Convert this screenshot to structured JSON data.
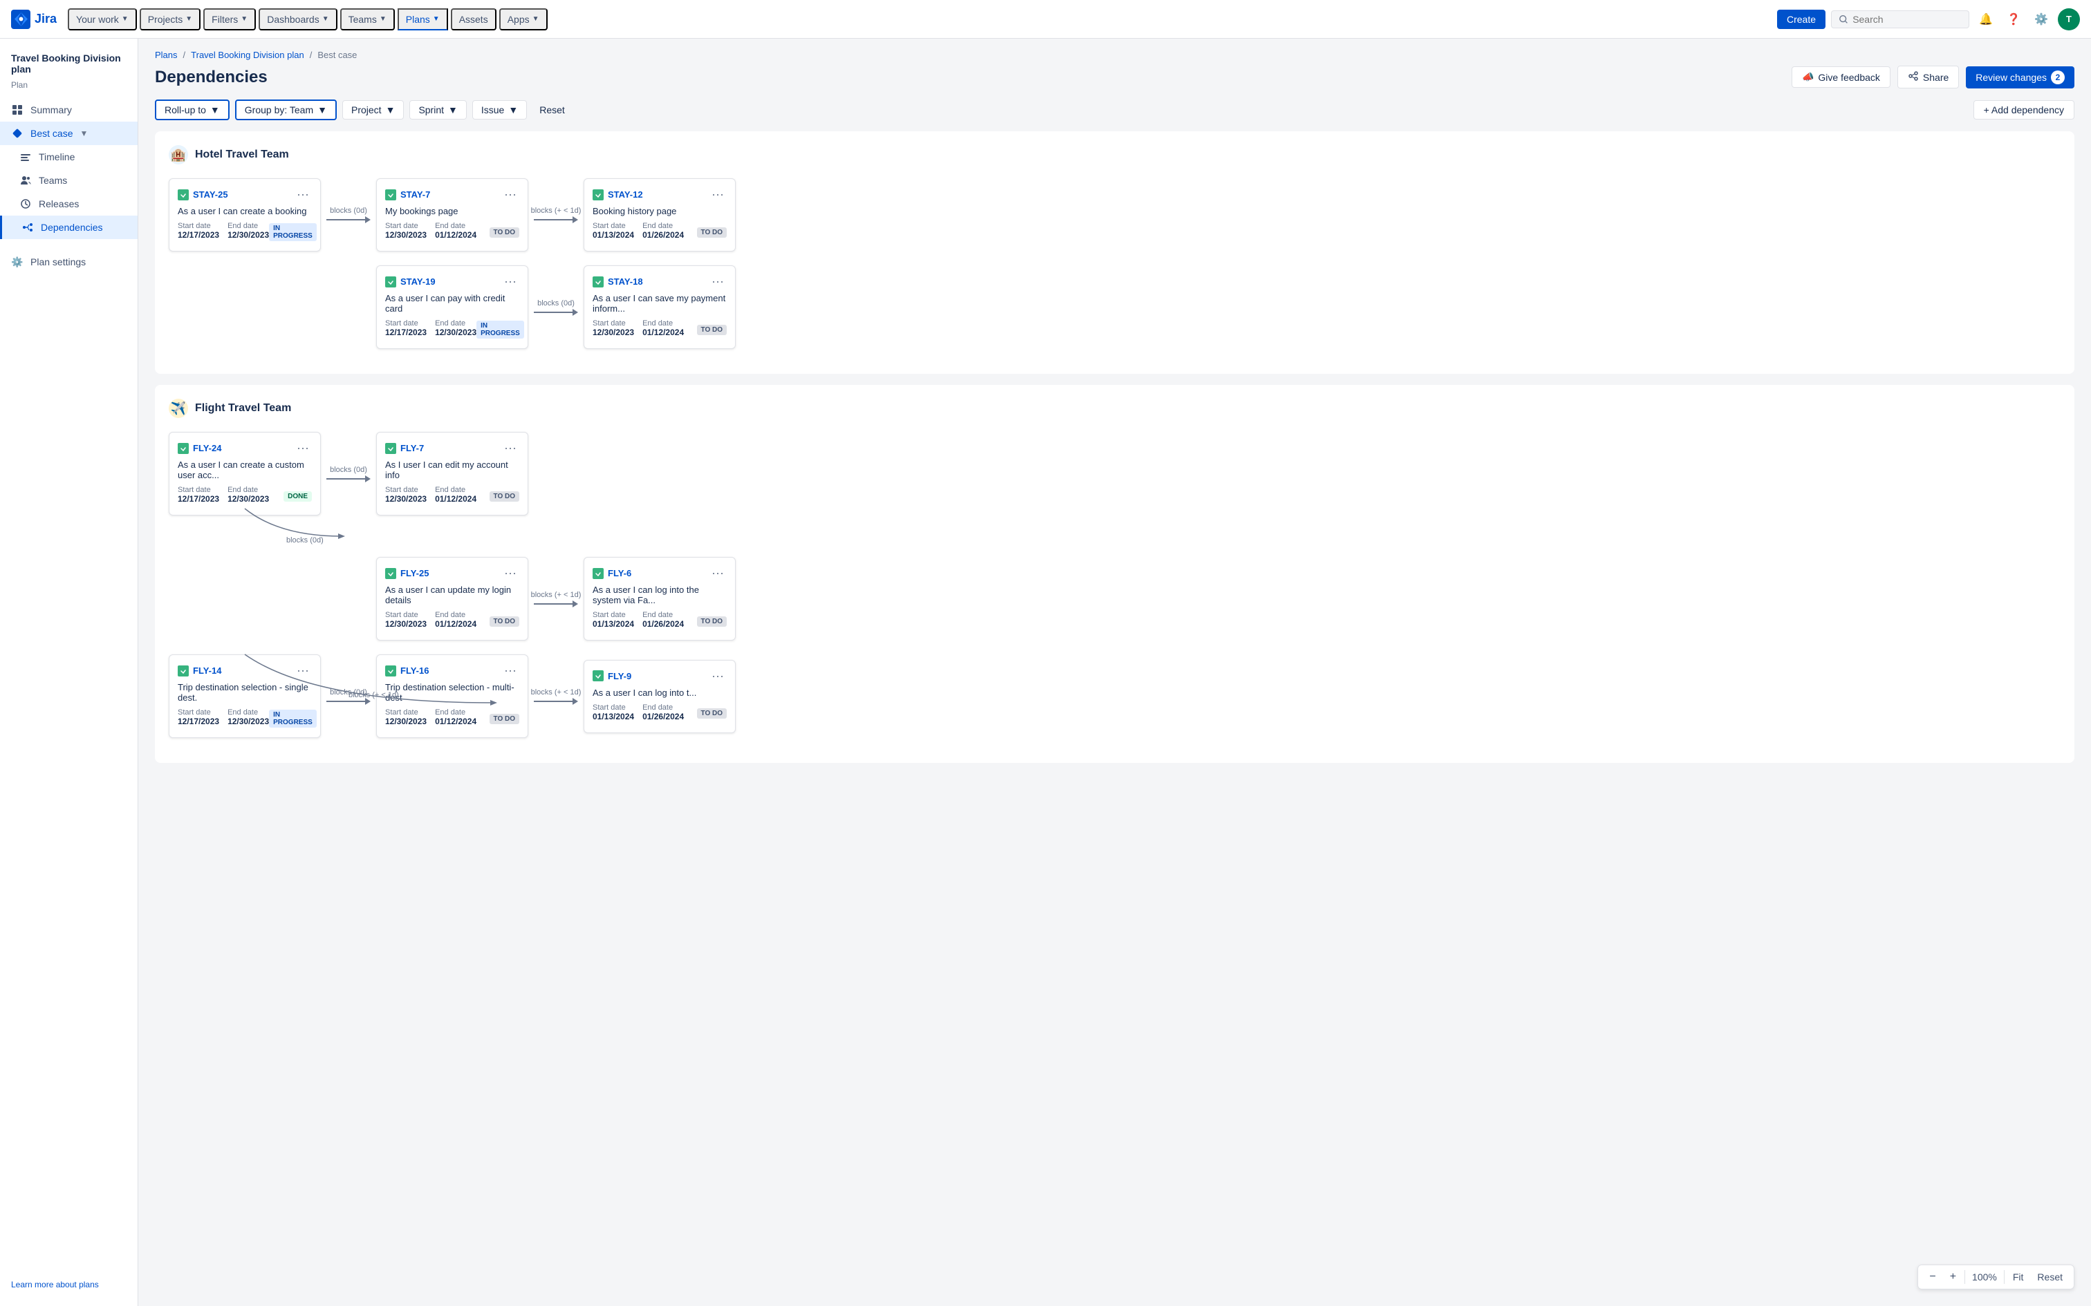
{
  "nav": {
    "logo_text": "Jira",
    "items": [
      {
        "label": "Your work",
        "has_chevron": true
      },
      {
        "label": "Projects",
        "has_chevron": true
      },
      {
        "label": "Filters",
        "has_chevron": true
      },
      {
        "label": "Dashboards",
        "has_chevron": true
      },
      {
        "label": "Teams",
        "has_chevron": true
      },
      {
        "label": "Plans",
        "has_chevron": true,
        "active": true
      },
      {
        "label": "Assets",
        "has_chevron": false
      },
      {
        "label": "Apps",
        "has_chevron": true
      }
    ],
    "create_label": "Create",
    "search_placeholder": "Search"
  },
  "sidebar": {
    "plan_title": "Travel Booking Division plan",
    "plan_sub": "Plan",
    "items": [
      {
        "label": "Summary",
        "icon": "grid"
      },
      {
        "label": "Best case",
        "icon": "diamond",
        "active": true,
        "expandable": true
      },
      {
        "label": "Timeline",
        "icon": "timeline"
      },
      {
        "label": "Teams",
        "icon": "teams"
      },
      {
        "label": "Releases",
        "icon": "releases"
      },
      {
        "label": "Dependencies",
        "icon": "deps",
        "selected": true
      }
    ],
    "settings_label": "Plan settings",
    "learn_label": "Learn more about plans"
  },
  "breadcrumbs": [
    "Plans",
    "Travel Booking Division plan",
    "Best case"
  ],
  "page_title": "Dependencies",
  "actions": {
    "feedback_label": "Give feedback",
    "share_label": "Share",
    "review_label": "Review changes",
    "review_count": "2"
  },
  "filters": {
    "rollup_label": "Roll-up to",
    "group_label": "Group by: Team",
    "project_label": "Project",
    "sprint_label": "Sprint",
    "issue_label": "Issue",
    "reset_label": "Reset",
    "add_dep_label": "+ Add dependency"
  },
  "hotel_team": {
    "name": "Hotel Travel Team",
    "icon": "🏨",
    "rows": [
      {
        "cards": [
          {
            "id": "STAY-25",
            "title": "As a user I can create a booking",
            "start_label": "Start date",
            "start": "12/17/2023",
            "end_label": "End date",
            "end": "12/30/2023",
            "status": "IN PROGRESS",
            "status_class": "status-in-progress"
          },
          {
            "arrow_label": "blocks (0d)",
            "id": "STAY-7",
            "title": "My bookings page",
            "start_label": "Start date",
            "start": "12/30/2023",
            "end_label": "End date",
            "end": "01/12/2024",
            "status": "TO DO",
            "status_class": "status-to-do"
          },
          {
            "arrow_label": "blocks (+ < 1d)",
            "id": "STAY-12",
            "title": "Booking history page",
            "start_label": "Start date",
            "start": "01/13/2024",
            "end_label": "End date",
            "end": "01/26/2024",
            "status": "TO DO",
            "status_class": "status-to-do"
          }
        ]
      },
      {
        "cards": [
          {
            "id": "STAY-19",
            "title": "As a user I can pay with credit card",
            "start_label": "Start date",
            "start": "12/17/2023",
            "end_label": "End date",
            "end": "12/30/2023",
            "status": "IN PROGRESS",
            "status_class": "status-in-progress"
          },
          {
            "arrow_label": "blocks (0d)",
            "id": "STAY-18",
            "title": "As a user I can save my payment inform...",
            "start_label": "Start date",
            "start": "12/30/2023",
            "end_label": "End date",
            "end": "01/12/2024",
            "status": "TO DO",
            "status_class": "status-to-do"
          }
        ]
      }
    ]
  },
  "flight_team": {
    "name": "Flight Travel Team",
    "icon": "✈️",
    "rows": [
      {
        "cards": [
          {
            "id": "FLY-24",
            "title": "As a user I can create a custom user acc...",
            "start_label": "Start date",
            "start": "12/17/2023",
            "end_label": "End date",
            "end": "12/30/2023",
            "status": "DONE",
            "status_class": "status-done"
          },
          {
            "arrow_label": "blocks (0d)",
            "id": "FLY-7",
            "title": "As I user I can edit my account info",
            "start_label": "Start date",
            "start": "12/30/2023",
            "end_label": "End date",
            "end": "01/12/2024",
            "status": "TO DO",
            "status_class": "status-to-do"
          }
        ]
      },
      {
        "cards": [
          {
            "id": "FLY-25",
            "title": "As a user I can update my login details",
            "start_label": "Start date",
            "start": "12/30/2023",
            "end_label": "End date",
            "end": "01/12/2024",
            "status": "TO DO",
            "status_class": "status-to-do"
          },
          {
            "arrow_label": "blocks (+ < 1d)",
            "id": "FLY-6",
            "title": "As a user I can log into the system via Fa...",
            "start_label": "Start date",
            "start": "01/13/2024",
            "end_label": "End date",
            "end": "01/26/2024",
            "status": "TO DO",
            "status_class": "status-to-do"
          }
        ]
      },
      {
        "cards": [
          {
            "id": "FLY-14",
            "title": "Trip destination selection - single dest.",
            "start_label": "Start date",
            "start": "12/17/2023",
            "end_label": "End date",
            "end": "12/30/2023",
            "status": "IN PROGRESS",
            "status_class": "status-in-progress"
          },
          {
            "arrow_label": "blocks (0d)",
            "id": "FLY-16",
            "title": "Trip destination selection - multi-dest",
            "start_label": "Start date",
            "start": "12/30/2023",
            "end_label": "End date",
            "end": "01/12/2024",
            "status": "TO DO",
            "status_class": "status-to-do"
          },
          {
            "arrow_label": "blocks (+ < 1d)",
            "id": "FLY-9",
            "title": "As a user I can log into t...",
            "start_label": "Start date",
            "start": "01/13/2024",
            "end_label": "End date",
            "end": "01/26/2024",
            "status": "TO DO",
            "status_class": "status-to-do"
          }
        ]
      }
    ],
    "cross_arrow_1": "blocks (0d)",
    "cross_arrow_2": "blocks (+ < 1d)"
  },
  "zoom": {
    "level": "100%",
    "fit_label": "Fit",
    "reset_label": "Reset"
  }
}
